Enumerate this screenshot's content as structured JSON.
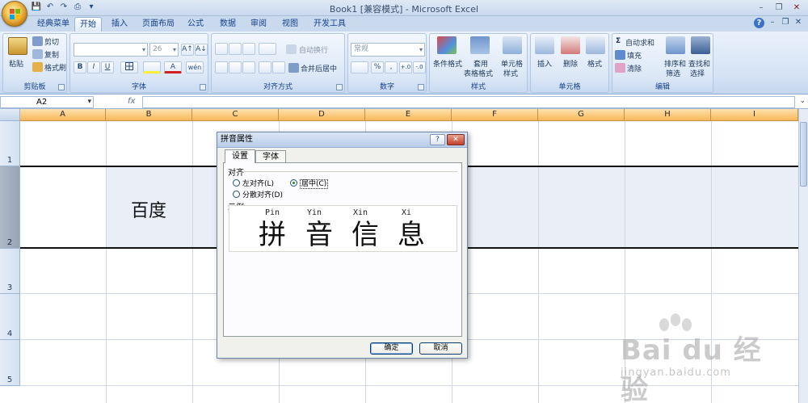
{
  "window": {
    "title_book": "Book1",
    "title_mode": "[兼容模式]",
    "title_sep": " - ",
    "title_app": "Microsoft Excel",
    "minimize": "–",
    "restore": "❐",
    "close": "✕"
  },
  "qat": {
    "save": "💾",
    "undo": "↶",
    "redo": "↷",
    "print": "⎙",
    "more": "▾"
  },
  "tabs": [
    "经典菜单",
    "开始",
    "插入",
    "页面布局",
    "公式",
    "数据",
    "审阅",
    "视图",
    "开发工具"
  ],
  "active_tab": "开始",
  "help": {
    "question": "?",
    "min": "–",
    "restore": "❐",
    "close": "✕"
  },
  "ribbon": {
    "clipboard": {
      "label": "剪贴板",
      "paste": "粘贴",
      "cut": "剪切",
      "copy": "复制",
      "painter": "格式刷"
    },
    "font": {
      "label": "字体",
      "font_size": "26",
      "bold": "B",
      "italic": "I",
      "underline": "U",
      "grow": "A↑",
      "shrink": "A↓",
      "fill": "A",
      "pinyin": "wén"
    },
    "alignment": {
      "label": "对齐方式",
      "wrap": "自动换行",
      "merge": "合并后居中"
    },
    "number": {
      "label": "数字",
      "format": "常规",
      "percent": "%",
      "comma": ",",
      "inc": "+.0",
      "dec": "-.0"
    },
    "styles": {
      "label": "样式",
      "conditional": "条件格式",
      "table": "套用表格格式",
      "cell": "单元格样式",
      "table_1": "套用",
      "table_2": "表格格式",
      "cell_1": "单元格",
      "cell_2": "样式"
    },
    "cells": {
      "label": "单元格",
      "insert": "插入",
      "delete": "删除",
      "format": "格式"
    },
    "editing": {
      "label": "编辑",
      "autosum": "自动求和",
      "fill": "填充",
      "clear": "清除",
      "sort_1": "排序和",
      "sort_2": "筛选",
      "find_1": "查找和",
      "find_2": "选择"
    }
  },
  "formula_bar": {
    "name_box": "A2",
    "fx": "fx",
    "content": ""
  },
  "sheet": {
    "columns": [
      "A",
      "B",
      "C",
      "D",
      "E",
      "F",
      "G",
      "H",
      "I"
    ],
    "rows": [
      "1",
      "2",
      "3",
      "4",
      "5"
    ],
    "cell_b2": "百度"
  },
  "dialog": {
    "title": "拼音属性",
    "help": "?",
    "close": "✕",
    "tabs": [
      "设置",
      "字体"
    ],
    "align_label": "对齐",
    "radio_left": "左对齐(L)",
    "radio_center": "居中(C)",
    "radio_distributed": "分散对齐(D)",
    "sample_label": "示例",
    "sample": [
      {
        "pinyin": "Pin",
        "char": "拼"
      },
      {
        "pinyin": "Yin",
        "char": "音"
      },
      {
        "pinyin": "Xin",
        "char": "信"
      },
      {
        "pinyin": "Xi",
        "char": "息"
      }
    ],
    "ok": "确定",
    "cancel": "取消"
  },
  "watermark": {
    "text": "Bai du 经验",
    "sub": "jingyan.baidu.com"
  },
  "colors": {
    "ribbon": "#d5e3f5",
    "col_header": "#f8b758",
    "row_selected": "#97a4b6"
  }
}
